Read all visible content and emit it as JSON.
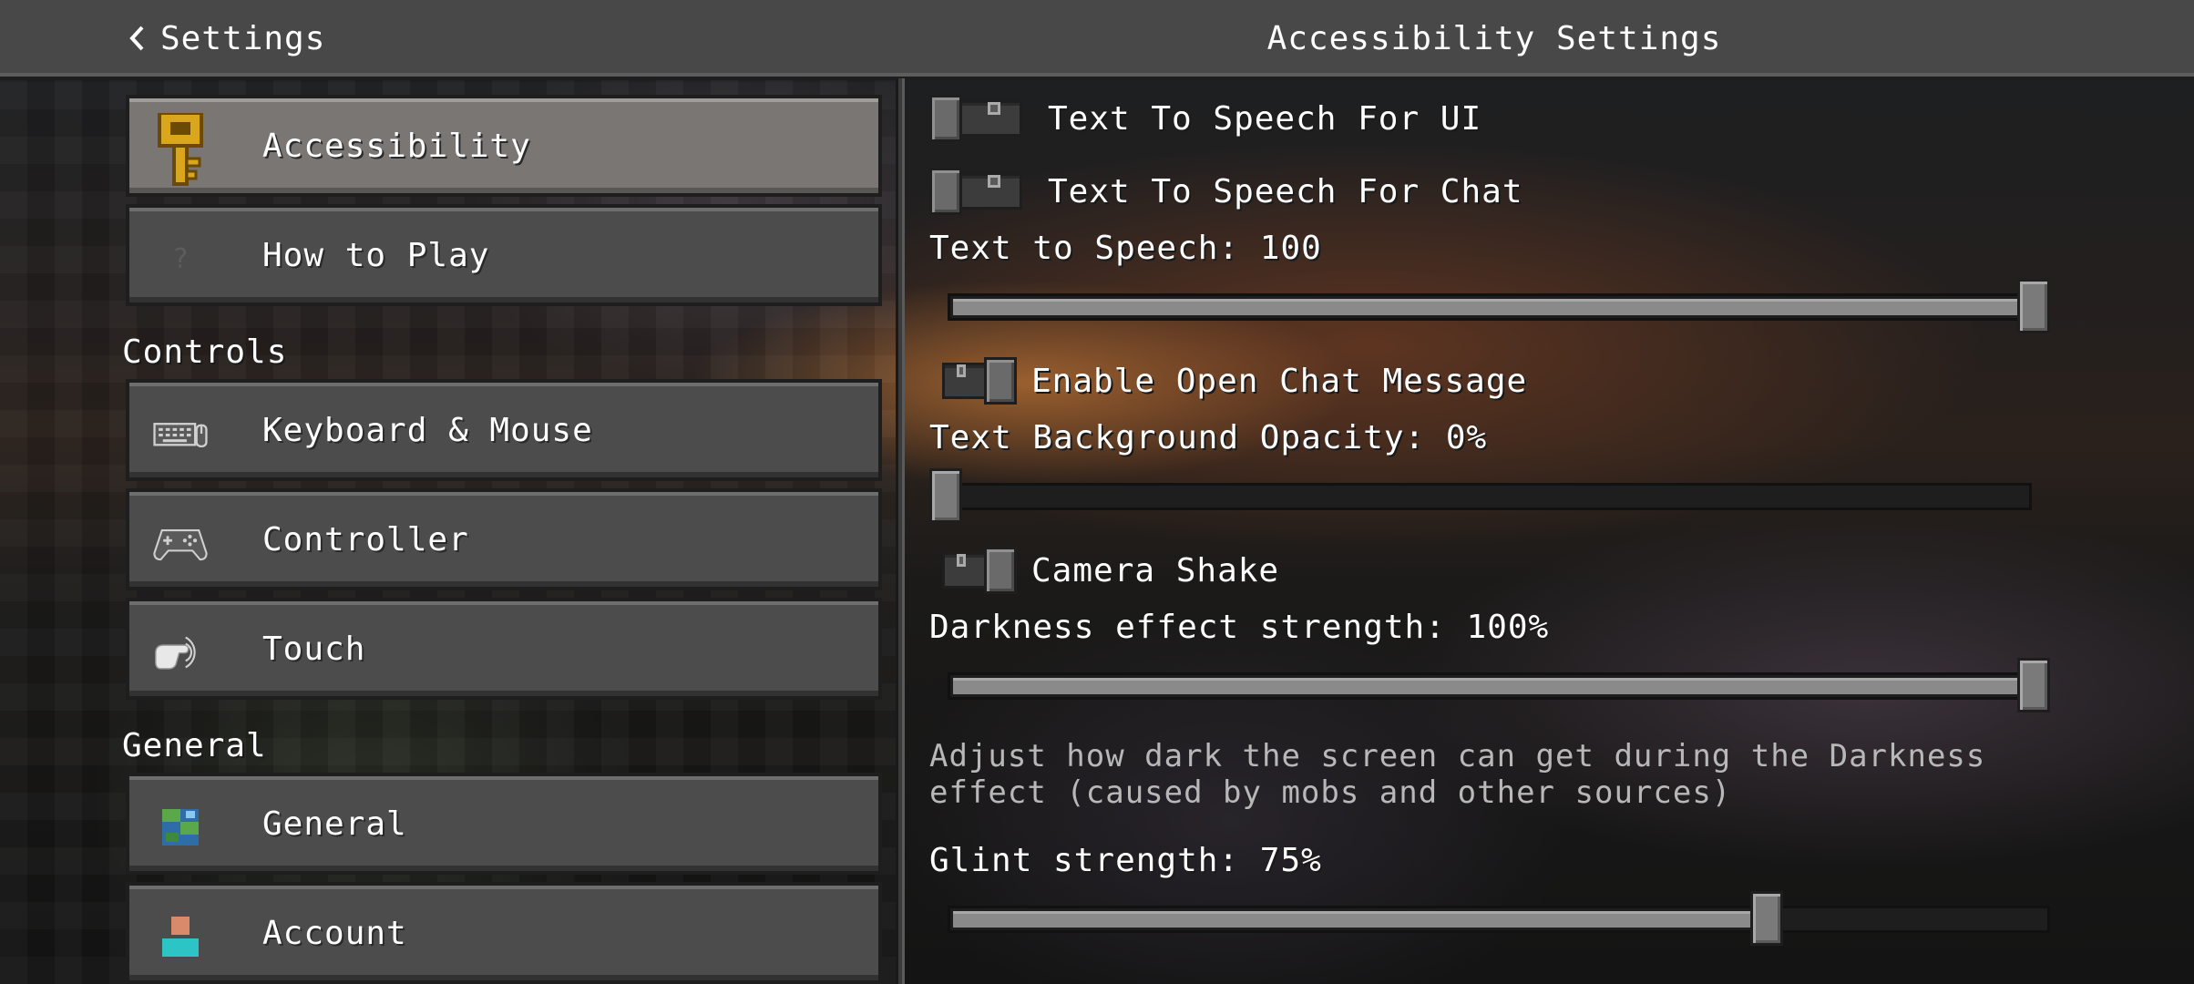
{
  "header": {
    "back_label": "Settings",
    "title": "Accessibility Settings"
  },
  "sidebar": {
    "items_top": [
      {
        "label": "Accessibility",
        "icon": "key-icon",
        "selected": true
      },
      {
        "label": "How to Play",
        "icon": "question-icon",
        "selected": false
      }
    ],
    "sections": [
      {
        "heading": "Controls",
        "items": [
          {
            "label": "Keyboard & Mouse",
            "icon": "keyboard-mouse-icon"
          },
          {
            "label": "Controller",
            "icon": "gamepad-icon"
          },
          {
            "label": "Touch",
            "icon": "touch-hand-icon"
          }
        ]
      },
      {
        "heading": "General",
        "items": [
          {
            "label": "General",
            "icon": "globe-icon"
          },
          {
            "label": "Account",
            "icon": "account-icon"
          }
        ]
      }
    ]
  },
  "settings": {
    "tts_ui": {
      "label": "Text To Speech For UI",
      "on": false
    },
    "tts_chat": {
      "label": "Text To Speech For Chat",
      "on": false
    },
    "tts_volume": {
      "label": "Text to Speech: 100",
      "value": 100,
      "min": 0,
      "max": 100
    },
    "open_chat": {
      "label": "Enable Open Chat Message",
      "on": true
    },
    "text_bg_opacity": {
      "label": "Text Background Opacity: 0%",
      "value": 0,
      "min": 0,
      "max": 100
    },
    "camera_shake": {
      "label": "Camera Shake",
      "on": true
    },
    "darkness": {
      "label": "Darkness effect strength: 100%",
      "value": 100,
      "min": 0,
      "max": 100,
      "description": "Adjust how dark the screen can get during the Darkness effect (caused by mobs and other sources)"
    },
    "glint": {
      "label": "Glint strength: 75%",
      "value": 75,
      "min": 0,
      "max": 100
    }
  },
  "colors": {
    "header_bg": "#484848",
    "button_bg": "#4c4c4c",
    "button_selected_bg": "#7a7673",
    "text": "#ffffff",
    "description_text": "#b8b8b8"
  }
}
